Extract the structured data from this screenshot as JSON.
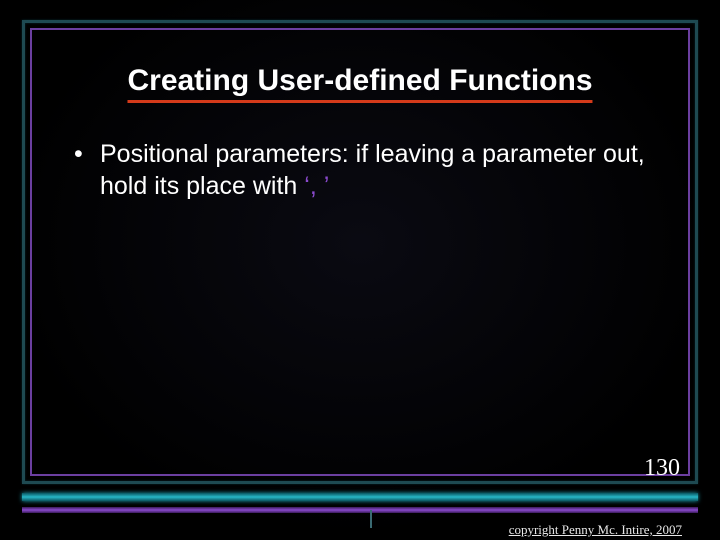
{
  "slide": {
    "title": "Creating User-defined Functions",
    "bullets": [
      {
        "text_before": "Positional parameters: if leaving a parameter out, hold its place with ",
        "token": "‘, ’",
        "text_after": ""
      }
    ],
    "page_number": "130",
    "copyright": "copyright Penny Mc. Intire, 2007"
  },
  "colors": {
    "title_underline": "#d43a1a",
    "teal": "#27b7c7",
    "purple": "#8a4acd"
  }
}
